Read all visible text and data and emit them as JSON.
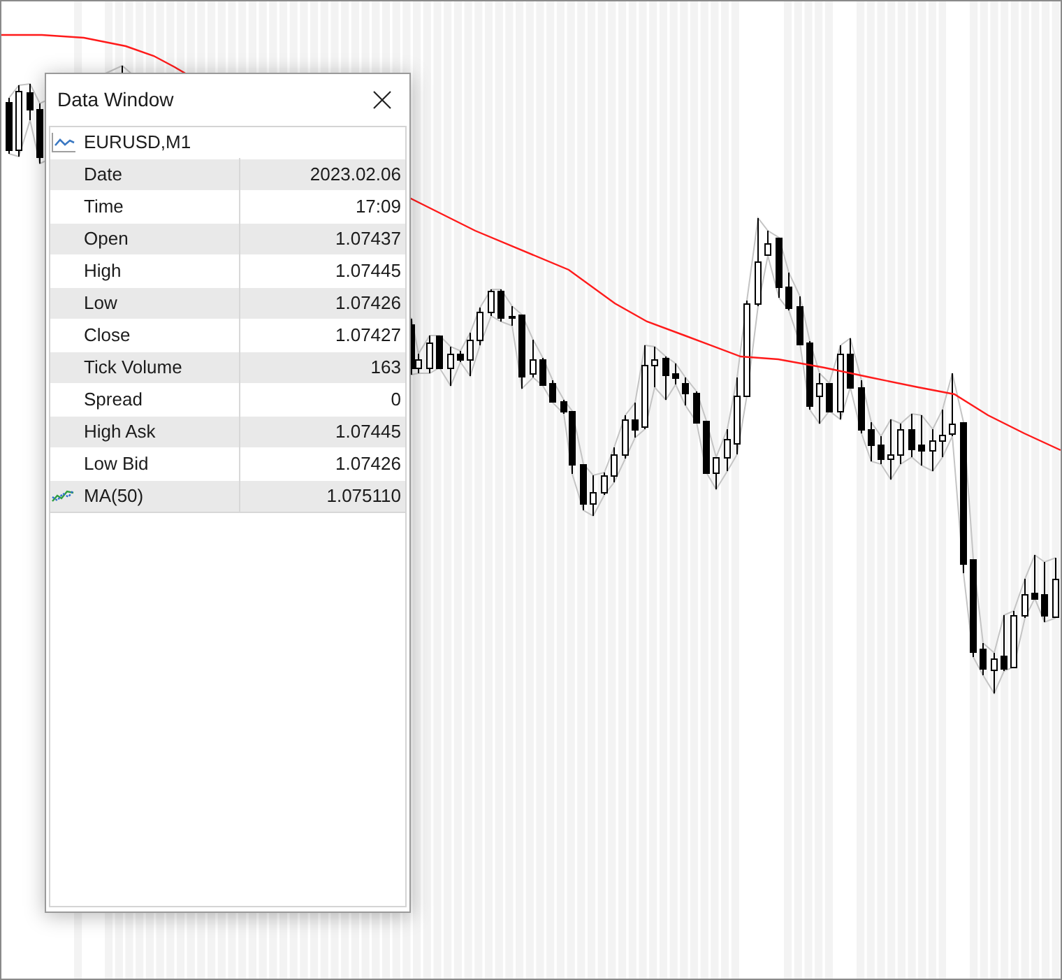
{
  "data_window": {
    "title": "Data Window",
    "symbol": "EURUSD,M1",
    "rows": [
      {
        "kind": "value",
        "label": "Date",
        "value": "2023.02.06"
      },
      {
        "kind": "value",
        "label": "Time",
        "value": "17:09"
      },
      {
        "kind": "value",
        "label": "Open",
        "value": "1.07437"
      },
      {
        "kind": "value",
        "label": "High",
        "value": "1.07445"
      },
      {
        "kind": "value",
        "label": "Low",
        "value": "1.07426"
      },
      {
        "kind": "value",
        "label": "Close",
        "value": "1.07427"
      },
      {
        "kind": "value",
        "label": "Tick Volume",
        "value": "163"
      },
      {
        "kind": "value",
        "label": "Spread",
        "value": "0"
      },
      {
        "kind": "value",
        "label": "High Ask",
        "value": "1.07445"
      },
      {
        "kind": "value",
        "label": "Low Bid",
        "value": "1.07426"
      },
      {
        "kind": "indicator",
        "label": "MA(50)",
        "value": "1.075110"
      }
    ]
  }
}
